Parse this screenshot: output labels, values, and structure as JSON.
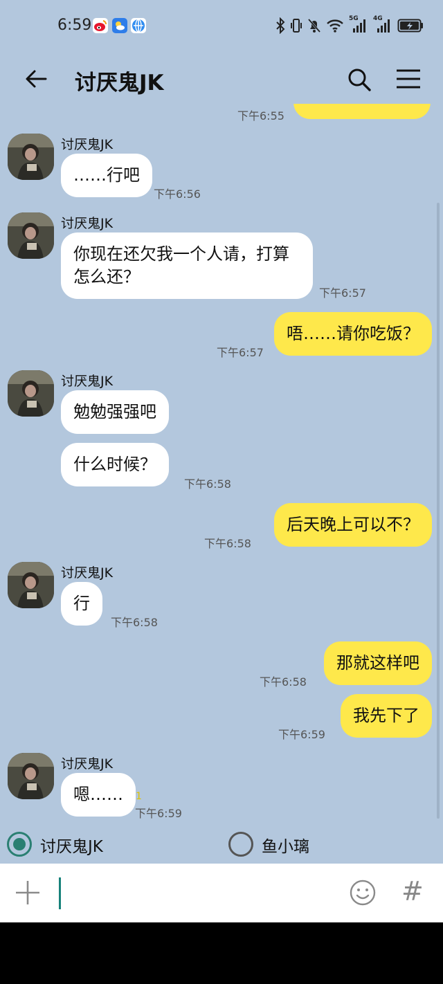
{
  "status_bar": {
    "time": "6:59",
    "apps": [
      "weibo-icon",
      "weather-icon",
      "browser-icon"
    ],
    "net1": "5G",
    "net2": "4G"
  },
  "header": {
    "title": "讨厌鬼JK"
  },
  "messages": {
    "top_time": "下午6:55",
    "g1": {
      "sender": "讨厌鬼JK",
      "m1": "……行吧",
      "t1": "下午6:56"
    },
    "g2": {
      "sender": "讨厌鬼JK",
      "m1": "你现在还欠我一个人请，打算怎么还？",
      "t1": "下午6:57"
    },
    "o1": {
      "text": "唔……请你吃饭？",
      "time": "下午6:57"
    },
    "g3": {
      "sender": "讨厌鬼JK",
      "m1": "勉勉强强吧",
      "m2": "什么时候？",
      "t2": "下午6:58"
    },
    "o2": {
      "text": "后天晚上可以不？",
      "time": "下午6:58"
    },
    "g4": {
      "sender": "讨厌鬼JK",
      "m1": "行",
      "t1": "下午6:58"
    },
    "o3": {
      "text": "那就这样吧",
      "time": "下午6:58"
    },
    "o4": {
      "text": "我先下了",
      "time": "下午6:59"
    },
    "g5": {
      "sender": "讨厌鬼JK",
      "m1": "嗯……",
      "unread": "1",
      "t1": "下午6:59"
    }
  },
  "targets": {
    "selected": "讨厌鬼JK",
    "other": "鱼小璃"
  },
  "input": {
    "value": "",
    "placeholder": ""
  },
  "colors": {
    "chat_bg": "#b3c7dd",
    "incoming_bubble": "#ffffff",
    "outgoing_bubble": "#fee84b",
    "accent": "#2a7f72"
  }
}
